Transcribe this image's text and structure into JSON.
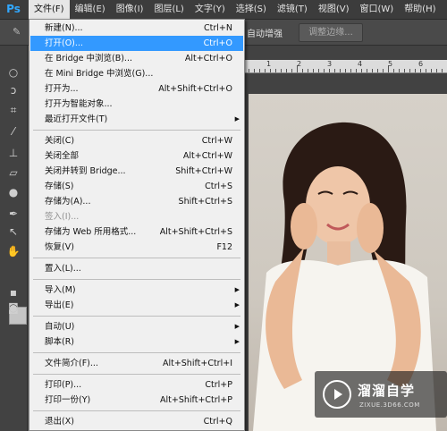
{
  "app": {
    "logo": "Ps"
  },
  "menubar": [
    {
      "label": "文件(F)",
      "active": true
    },
    {
      "label": "编辑(E)"
    },
    {
      "label": "图像(I)"
    },
    {
      "label": "图层(L)"
    },
    {
      "label": "文字(Y)"
    },
    {
      "label": "选择(S)"
    },
    {
      "label": "滤镜(T)"
    },
    {
      "label": "视图(V)"
    },
    {
      "label": "窗口(W)"
    },
    {
      "label": "帮助(H)"
    }
  ],
  "options": {
    "auto_enhance": "自动增强",
    "refine_edge": "调整边缘..."
  },
  "ruler": {
    "labels": [
      "1",
      "2",
      "3",
      "4",
      "5",
      "6"
    ]
  },
  "file_menu": {
    "items": [
      {
        "label": "新建(N)...",
        "shortcut": "Ctrl+N"
      },
      {
        "label": "打开(O)...",
        "shortcut": "Ctrl+O",
        "highlighted": true
      },
      {
        "label": "在 Bridge 中浏览(B)...",
        "shortcut": "Alt+Ctrl+O"
      },
      {
        "label": "在 Mini Bridge 中浏览(G)...",
        "shortcut": ""
      },
      {
        "label": "打开为...",
        "shortcut": "Alt+Shift+Ctrl+O"
      },
      {
        "label": "打开为智能对象...",
        "shortcut": ""
      },
      {
        "label": "最近打开文件(T)",
        "shortcut": "",
        "submenu": true
      },
      {
        "label": "关闭(C)",
        "shortcut": "Ctrl+W"
      },
      {
        "label": "关闭全部",
        "shortcut": "Alt+Ctrl+W"
      },
      {
        "label": "关闭并转到 Bridge...",
        "shortcut": "Shift+Ctrl+W"
      },
      {
        "label": "存储(S)",
        "shortcut": "Ctrl+S"
      },
      {
        "label": "存储为(A)...",
        "shortcut": "Shift+Ctrl+S"
      },
      {
        "label": "签入(I)...",
        "shortcut": "",
        "disabled": true
      },
      {
        "label": "存储为 Web 所用格式...",
        "shortcut": "Alt+Shift+Ctrl+S"
      },
      {
        "label": "恢复(V)",
        "shortcut": "F12"
      },
      {
        "label": "置入(L)...",
        "shortcut": ""
      },
      {
        "label": "导入(M)",
        "shortcut": "",
        "submenu": true
      },
      {
        "label": "导出(E)",
        "shortcut": "",
        "submenu": true
      },
      {
        "label": "自动(U)",
        "shortcut": "",
        "submenu": true
      },
      {
        "label": "脚本(R)",
        "shortcut": "",
        "submenu": true
      },
      {
        "label": "文件简介(F)...",
        "shortcut": "Alt+Shift+Ctrl+I"
      },
      {
        "label": "打印(P)...",
        "shortcut": "Ctrl+P"
      },
      {
        "label": "打印一份(Y)",
        "shortcut": "Alt+Shift+Ctrl+P"
      },
      {
        "label": "退出(X)",
        "shortcut": "Ctrl+Q"
      }
    ],
    "submenu_arrow": "▶"
  },
  "watermark": {
    "title": "溜溜自学",
    "url": "ZIXUE.3D66.COM"
  },
  "colors": {
    "highlight": "#3399ff",
    "menu_bg": "#f0f0f0",
    "workspace": "#535353"
  }
}
